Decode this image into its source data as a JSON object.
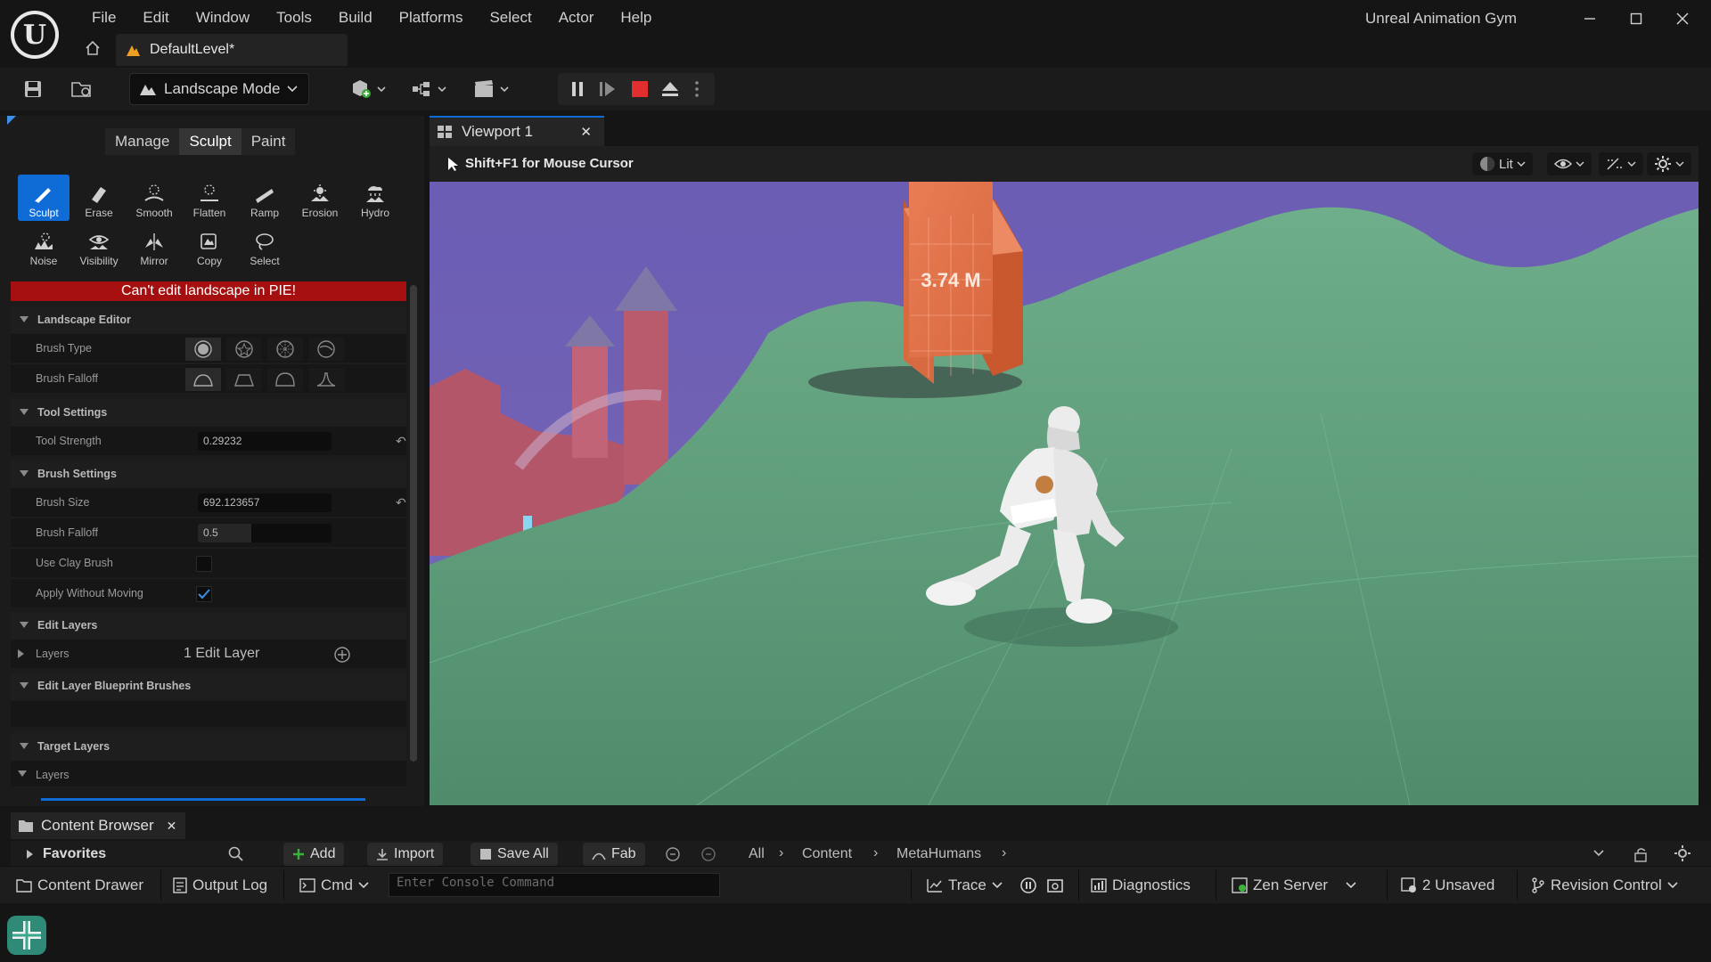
{
  "app": {
    "title": "Unreal Animation Gym",
    "logo_icon": "unreal-logo-icon",
    "document_tab": "DefaultLevel*"
  },
  "menu": [
    "File",
    "Edit",
    "Window",
    "Tools",
    "Build",
    "Platforms",
    "Select",
    "Actor",
    "Help"
  ],
  "toolbar": {
    "mode_label": "Landscape Mode",
    "play_stop_color": "#e12f2f"
  },
  "landscape_panel": {
    "mode_tabs": [
      "Manage",
      "Sculpt",
      "Paint"
    ],
    "active_mode_tab": "Sculpt",
    "tools_row1": [
      "Sculpt",
      "Erase",
      "Smooth",
      "Flatten",
      "Ramp",
      "Erosion",
      "Hydro"
    ],
    "tools_row2": [
      "Noise",
      "Visibility",
      "Mirror",
      "Copy",
      "Select"
    ],
    "active_tool": "Sculpt",
    "warning": "Can't edit landscape in PIE!",
    "sections": {
      "landscape_editor": "Landscape Editor",
      "tool_settings": "Tool Settings",
      "brush_settings": "Brush Settings",
      "edit_layers": "Edit Layers",
      "blueprint_brushes": "Edit Layer Blueprint Brushes",
      "target_layers": "Target Layers"
    },
    "props": {
      "brush_type": "Brush Type",
      "brush_falloff_shape": "Brush Falloff",
      "tool_strength_label": "Tool Strength",
      "tool_strength_value": "0.29232",
      "brush_size_label": "Brush Size",
      "brush_size_value": "692.123657",
      "brush_falloff_label": "Brush Falloff",
      "brush_falloff_value": "0.5",
      "use_clay_brush_label": "Use Clay Brush",
      "use_clay_brush": false,
      "apply_without_moving_label": "Apply Without Moving",
      "apply_without_moving": true,
      "layers_label": "Layers",
      "layers_value": "1 Edit Layer",
      "target_layers_label": "Layers"
    }
  },
  "viewport": {
    "tab_label": "Viewport 1",
    "hint": "Shift+F1 for Mouse Cursor",
    "view_mode": "Lit",
    "cube_label": "3.74 M",
    "sky_color": "#6b5fb0",
    "ground_color": "#5e9b7a",
    "cube_color": "#e5774f"
  },
  "content_browser": {
    "tab_label": "Content Browser",
    "favorites": "Favorites",
    "add": "Add",
    "import": "Import",
    "save_all": "Save All",
    "fab": "Fab",
    "path": [
      "All",
      "Content",
      "MetaHumans"
    ]
  },
  "statusbar": {
    "content_drawer": "Content Drawer",
    "output_log": "Output Log",
    "cmd": "Cmd",
    "console_placeholder": "Enter Console Command",
    "trace": "Trace",
    "diagnostics": "Diagnostics",
    "zen_server": "Zen Server",
    "unsaved": "2 Unsaved",
    "revision_control": "Revision Control"
  }
}
